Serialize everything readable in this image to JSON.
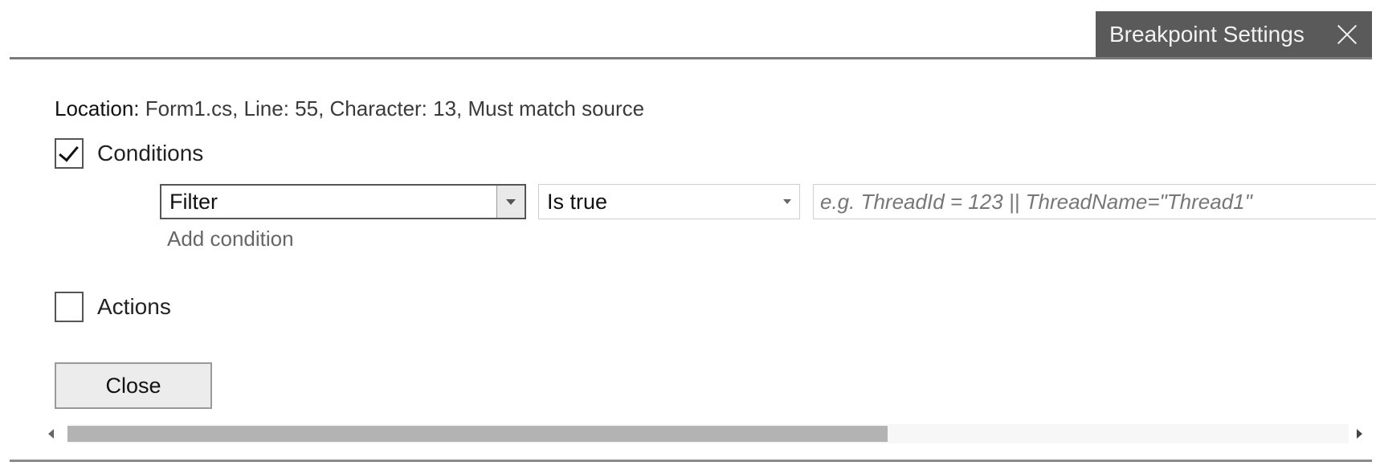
{
  "panel": {
    "tab_title": "Breakpoint Settings",
    "close_glyph": "×"
  },
  "location": {
    "label": "Location:",
    "value": "Form1.cs, Line: 55, Character: 13, Must match source"
  },
  "conditions": {
    "label": "Conditions",
    "checked": true,
    "condition_type": "Filter",
    "operator": "Is true",
    "expression": "",
    "expression_placeholder": "e.g. ThreadId = 123 || ThreadName=\"Thread1\"",
    "add_condition_label": "Add condition"
  },
  "actions": {
    "label": "Actions",
    "checked": false
  },
  "buttons": {
    "close_label": "Close"
  },
  "scrollbar": {
    "visible_fraction": 0.64,
    "position_fraction": 0.0
  },
  "icons": {
    "tab_close": "close-icon",
    "check": "checkmark-icon",
    "dropdown": "chevron-down-icon",
    "scroll_left": "scroll-left-arrow-icon",
    "scroll_right": "scroll-right-arrow-icon"
  },
  "colors": {
    "tab_background": "#5a5a5a",
    "tab_text": "#f2f2f2",
    "scroll_thumb": "#b3b3b3",
    "add_condition_text": "#666666"
  }
}
